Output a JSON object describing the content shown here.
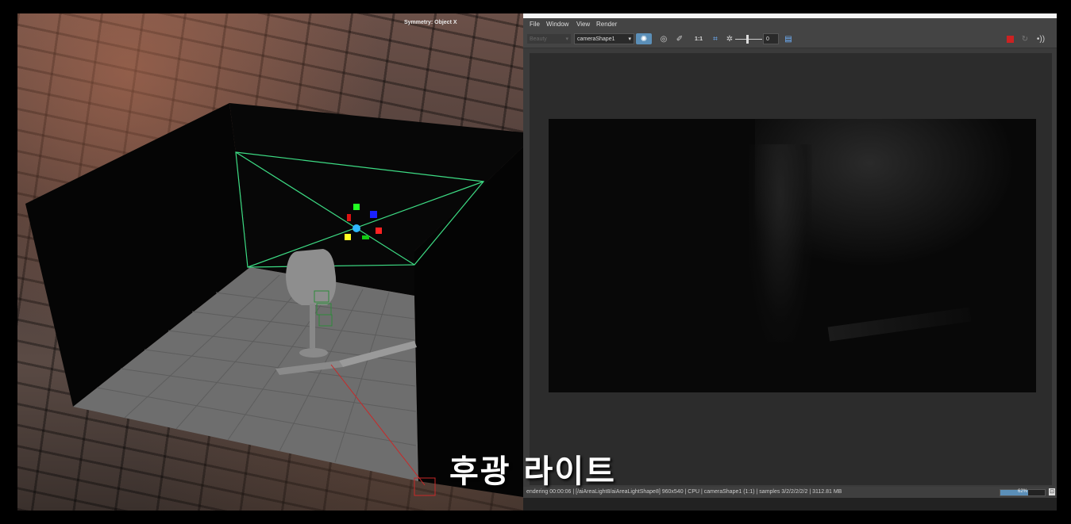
{
  "viewport": {
    "symmetry_label": "Symmetry: Object X"
  },
  "caption": "후광 라이트",
  "renderview": {
    "menu": [
      "File",
      "Window",
      "View",
      "Render"
    ],
    "toolbar": {
      "aov_select": "Beauty",
      "camera_select": "cameraShape1",
      "ratio_label": "1:1",
      "exposure_value": "0"
    },
    "status": {
      "text": "endering 00:00:06 |    [/aiAreaLight8/aiAreaLightShape8]  960x540 | CPU | cameraShape1 (1:1) | samples 3/2/2/2/2/2 | 3112.81 MB",
      "progress_percent": 62,
      "progress_label": "62%"
    },
    "icons": {
      "render_settings": "sun-gear-icon",
      "ipr": "ipr-icon",
      "snapshot": "pin-icon",
      "crop": "crop-icon",
      "stop": "stop-icon",
      "refresh": "refresh-icon",
      "audio": "speaker-icon"
    },
    "colors": {
      "stop": "#cc2222",
      "accent": "#5b8fb8"
    }
  }
}
